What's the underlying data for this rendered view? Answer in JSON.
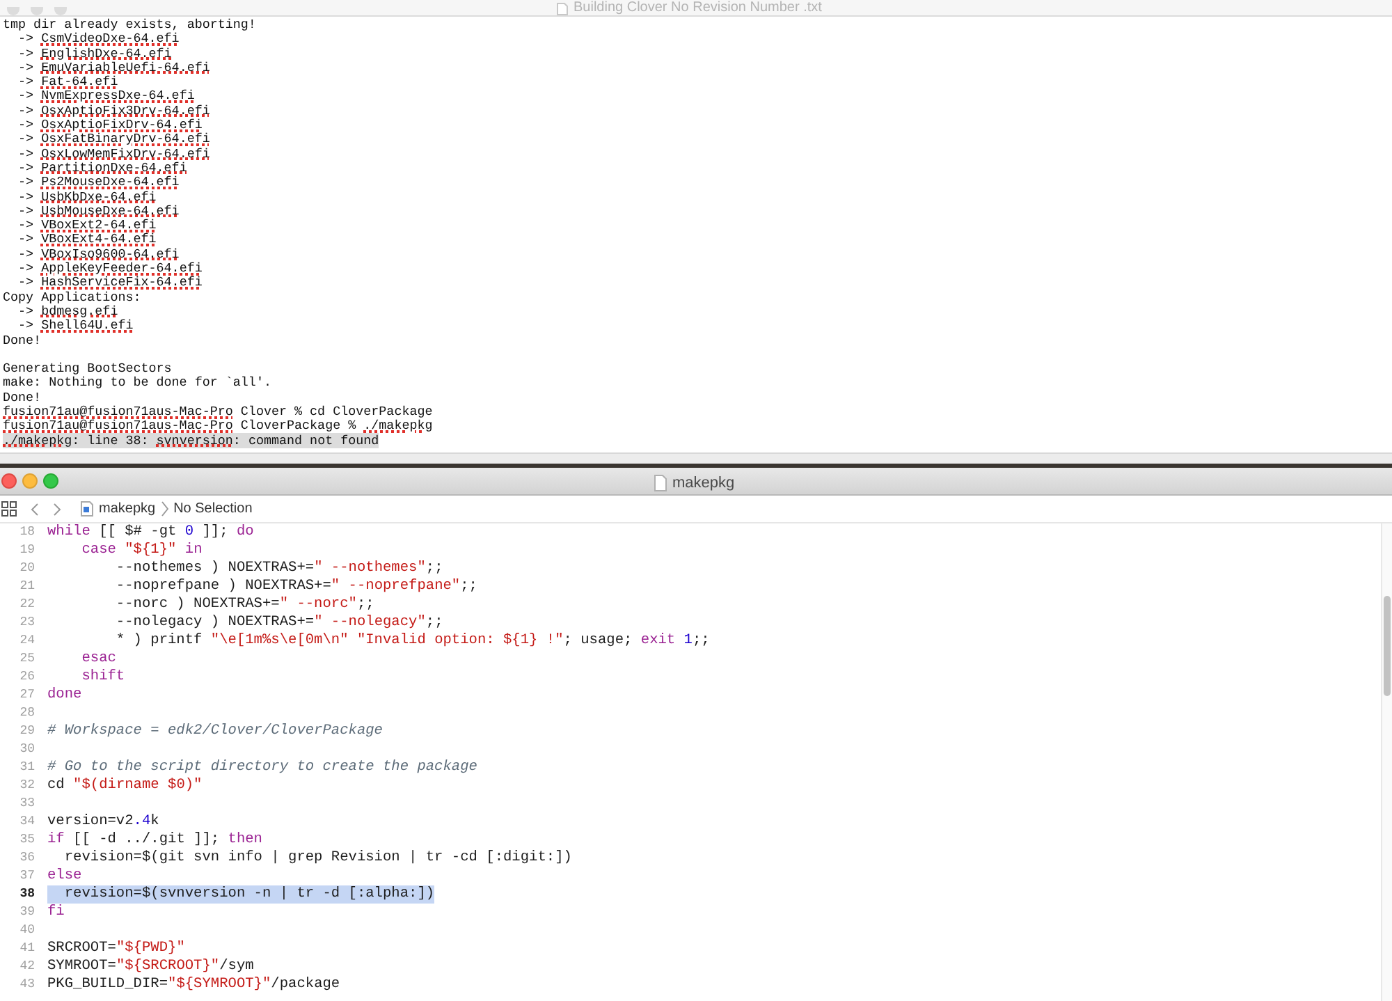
{
  "terminal_window": {
    "title": "Building Clover No Revision Number .txt",
    "lines": [
      {
        "parts": [
          {
            "text": "tmp dir already exists, aborting!",
            "misspelled": false
          }
        ]
      },
      {
        "parts": [
          {
            "text": "  -> ",
            "misspelled": false
          },
          {
            "text": "CsmVideoDxe-64.efi",
            "misspelled": true
          }
        ]
      },
      {
        "parts": [
          {
            "text": "  -> ",
            "misspelled": false
          },
          {
            "text": "EnglishDxe-64.efi",
            "misspelled": true
          }
        ]
      },
      {
        "parts": [
          {
            "text": "  -> ",
            "misspelled": false
          },
          {
            "text": "EmuVariableUefi-64.efi",
            "misspelled": true
          }
        ]
      },
      {
        "parts": [
          {
            "text": "  -> ",
            "misspelled": false
          },
          {
            "text": "Fat-64.efi",
            "misspelled": true
          }
        ]
      },
      {
        "parts": [
          {
            "text": "  -> ",
            "misspelled": false
          },
          {
            "text": "NvmExpressDxe-64.efi",
            "misspelled": true
          }
        ]
      },
      {
        "parts": [
          {
            "text": "  -> ",
            "misspelled": false
          },
          {
            "text": "OsxAptioFix3Drv-64.efi",
            "misspelled": true
          }
        ]
      },
      {
        "parts": [
          {
            "text": "  -> ",
            "misspelled": false
          },
          {
            "text": "OsxAptioFixDrv-64.efi",
            "misspelled": true
          }
        ]
      },
      {
        "parts": [
          {
            "text": "  -> ",
            "misspelled": false
          },
          {
            "text": "OsxFatBinaryDrv-64.efi",
            "misspelled": true
          }
        ]
      },
      {
        "parts": [
          {
            "text": "  -> ",
            "misspelled": false
          },
          {
            "text": "OsxLowMemFixDrv-64.efi",
            "misspelled": true
          }
        ]
      },
      {
        "parts": [
          {
            "text": "  -> ",
            "misspelled": false
          },
          {
            "text": "PartitionDxe-64.efi",
            "misspelled": true
          }
        ]
      },
      {
        "parts": [
          {
            "text": "  -> ",
            "misspelled": false
          },
          {
            "text": "Ps2MouseDxe-64.efi",
            "misspelled": true
          }
        ]
      },
      {
        "parts": [
          {
            "text": "  -> ",
            "misspelled": false
          },
          {
            "text": "UsbKbDxe-64.efi",
            "misspelled": true
          }
        ]
      },
      {
        "parts": [
          {
            "text": "  -> ",
            "misspelled": false
          },
          {
            "text": "UsbMouseDxe-64.efi",
            "misspelled": true
          }
        ]
      },
      {
        "parts": [
          {
            "text": "  -> ",
            "misspelled": false
          },
          {
            "text": "VBoxExt2-64.efi",
            "misspelled": true
          }
        ]
      },
      {
        "parts": [
          {
            "text": "  -> ",
            "misspelled": false
          },
          {
            "text": "VBoxExt4-64.efi",
            "misspelled": true
          }
        ]
      },
      {
        "parts": [
          {
            "text": "  -> ",
            "misspelled": false
          },
          {
            "text": "VBoxIso9600-64.efi",
            "misspelled": true
          }
        ]
      },
      {
        "parts": [
          {
            "text": "  -> ",
            "misspelled": false
          },
          {
            "text": "AppleKeyFeeder-64.efi",
            "misspelled": true
          }
        ]
      },
      {
        "parts": [
          {
            "text": "  -> ",
            "misspelled": false
          },
          {
            "text": "HashServiceFix-64.efi",
            "misspelled": true
          }
        ]
      },
      {
        "parts": [
          {
            "text": "Copy Applications:",
            "misspelled": false
          }
        ]
      },
      {
        "parts": [
          {
            "text": "  -> ",
            "misspelled": false
          },
          {
            "text": "bdmesg.efi",
            "misspelled": true
          }
        ]
      },
      {
        "parts": [
          {
            "text": "  -> ",
            "misspelled": false
          },
          {
            "text": "Shell64U.efi",
            "misspelled": true
          }
        ]
      },
      {
        "parts": [
          {
            "text": "Done!",
            "misspelled": false
          }
        ]
      },
      {
        "gap_before": true,
        "parts": [
          {
            "text": "Generating BootSectors",
            "misspelled": false
          }
        ]
      },
      {
        "parts": [
          {
            "text": "make: Nothing to be done for `all'.",
            "misspelled": false
          }
        ]
      },
      {
        "parts": [
          {
            "text": "Done!",
            "misspelled": false
          }
        ]
      },
      {
        "parts": [
          {
            "text": "fusion71au@fusion71aus-Mac-Pro",
            "misspelled": true
          },
          {
            "text": " Clover % cd CloverPackage",
            "misspelled": false
          }
        ]
      },
      {
        "parts": [
          {
            "text": "fusion71au@fusion71aus-Mac-Pro",
            "misspelled": true
          },
          {
            "text": " CloverPackage % ",
            "misspelled": false
          },
          {
            "text": "./makepkg",
            "misspelled": true
          }
        ]
      },
      {
        "highlighted": true,
        "parts": [
          {
            "text": "./makepkg",
            "misspelled": true
          },
          {
            "text": ": line 38: ",
            "misspelled": false
          },
          {
            "text": "svnversion",
            "misspelled": true
          },
          {
            "text": ": command not found",
            "misspelled": false
          }
        ]
      }
    ]
  },
  "editor_window": {
    "title": "makepkg",
    "breadcrumb": [
      "makepkg",
      "No Selection"
    ],
    "lines": [
      {
        "number": "18",
        "selected": false,
        "tokens": [
          {
            "kind": "keyword",
            "text": "while"
          },
          {
            "kind": "plain",
            "text": " [[ $# -gt "
          },
          {
            "kind": "number",
            "text": "0"
          },
          {
            "kind": "plain",
            "text": " ]]; "
          },
          {
            "kind": "keyword",
            "text": "do"
          }
        ]
      },
      {
        "number": "19",
        "selected": false,
        "tokens": [
          {
            "kind": "keyword",
            "text": "    case "
          },
          {
            "kind": "string",
            "text": "\"${1}\" "
          },
          {
            "kind": "keyword",
            "text": "in"
          }
        ]
      },
      {
        "number": "20",
        "selected": false,
        "tokens": [
          {
            "kind": "plain",
            "text": "        --nothemes ) NOEXTRAS+="
          },
          {
            "kind": "string",
            "text": "\" --nothemes\""
          },
          {
            "kind": "plain",
            "text": ";;"
          }
        ]
      },
      {
        "number": "21",
        "selected": false,
        "tokens": [
          {
            "kind": "plain",
            "text": "        --noprefpane ) NOEXTRAS+="
          },
          {
            "kind": "string",
            "text": "\" --noprefpane\""
          },
          {
            "kind": "plain",
            "text": ";;"
          }
        ]
      },
      {
        "number": "22",
        "selected": false,
        "tokens": [
          {
            "kind": "plain",
            "text": "        --norc ) NOEXTRAS+="
          },
          {
            "kind": "string",
            "text": "\" --norc\""
          },
          {
            "kind": "plain",
            "text": ";;"
          }
        ]
      },
      {
        "number": "23",
        "selected": false,
        "tokens": [
          {
            "kind": "plain",
            "text": "        --nolegacy ) NOEXTRAS+="
          },
          {
            "kind": "string",
            "text": "\" --nolegacy\""
          },
          {
            "kind": "plain",
            "text": ";;"
          }
        ]
      },
      {
        "number": "24",
        "selected": false,
        "tokens": [
          {
            "kind": "plain",
            "text": "        * ) printf "
          },
          {
            "kind": "string",
            "text": "\"\\e[1m%s\\e[0m\\n\" \"Invalid option: ${1} !\""
          },
          {
            "kind": "plain",
            "text": "; usage; "
          },
          {
            "kind": "keyword",
            "text": "exit "
          },
          {
            "kind": "number",
            "text": "1"
          },
          {
            "kind": "plain",
            "text": ";;"
          }
        ]
      },
      {
        "number": "25",
        "selected": false,
        "tokens": [
          {
            "kind": "keyword",
            "text": "    esac"
          }
        ]
      },
      {
        "number": "26",
        "selected": false,
        "tokens": [
          {
            "kind": "keyword",
            "text": "    shift"
          }
        ]
      },
      {
        "number": "27",
        "selected": false,
        "tokens": [
          {
            "kind": "keyword",
            "text": "done"
          }
        ]
      },
      {
        "number": "28",
        "selected": false
      },
      {
        "number": "29",
        "selected": false,
        "tokens": [
          {
            "kind": "comment",
            "text": "# Workspace = edk2/Clover/CloverPackage"
          }
        ]
      },
      {
        "number": "30",
        "selected": false
      },
      {
        "number": "31",
        "selected": false,
        "tokens": [
          {
            "kind": "comment",
            "text": "# Go to the script directory to create the package"
          }
        ]
      },
      {
        "number": "32",
        "selected": false,
        "tokens": [
          {
            "kind": "plain",
            "text": "cd "
          },
          {
            "kind": "string",
            "text": "\"$(dirname $0)\""
          }
        ]
      },
      {
        "number": "33",
        "selected": false
      },
      {
        "number": "34",
        "selected": false,
        "tokens": [
          {
            "kind": "plain",
            "text": "version=v2"
          },
          {
            "kind": "number",
            "text": ".4"
          },
          {
            "kind": "plain",
            "text": "k"
          }
        ]
      },
      {
        "number": "35",
        "selected": false,
        "tokens": [
          {
            "kind": "keyword",
            "text": "if"
          },
          {
            "kind": "plain",
            "text": " [[ -d ../.git ]]; "
          },
          {
            "kind": "keyword",
            "text": "then"
          }
        ]
      },
      {
        "number": "36",
        "selected": false,
        "tokens": [
          {
            "kind": "plain",
            "text": "  revision=$(git svn info | grep Revision | tr -cd [:digit:])"
          }
        ]
      },
      {
        "number": "37",
        "selected": false,
        "tokens": [
          {
            "kind": "keyword",
            "text": "else"
          }
        ]
      },
      {
        "number": "38",
        "selected": true,
        "tokens": [
          {
            "kind": "plain",
            "text": "  revision=$(svnversion -n | tr -d [:alpha:])"
          }
        ]
      },
      {
        "number": "39",
        "selected": false,
        "tokens": [
          {
            "kind": "keyword",
            "text": "fi"
          }
        ]
      },
      {
        "number": "40",
        "selected": false
      },
      {
        "number": "41",
        "selected": false,
        "tokens": [
          {
            "kind": "plain",
            "text": "SRCROOT="
          },
          {
            "kind": "string",
            "text": "\"${PWD}\""
          }
        ]
      },
      {
        "number": "42",
        "selected": false,
        "tokens": [
          {
            "kind": "plain",
            "text": "SYMROOT="
          },
          {
            "kind": "string",
            "text": "\"${SRCROOT}\""
          },
          {
            "kind": "plain",
            "text": "/sym"
          }
        ]
      },
      {
        "number": "43",
        "selected": false,
        "tokens": [
          {
            "kind": "plain",
            "text": "PKG_BUILD_DIR="
          },
          {
            "kind": "string",
            "text": "\"${SYMROOT}\""
          },
          {
            "kind": "plain",
            "text": "/package"
          }
        ]
      }
    ]
  }
}
